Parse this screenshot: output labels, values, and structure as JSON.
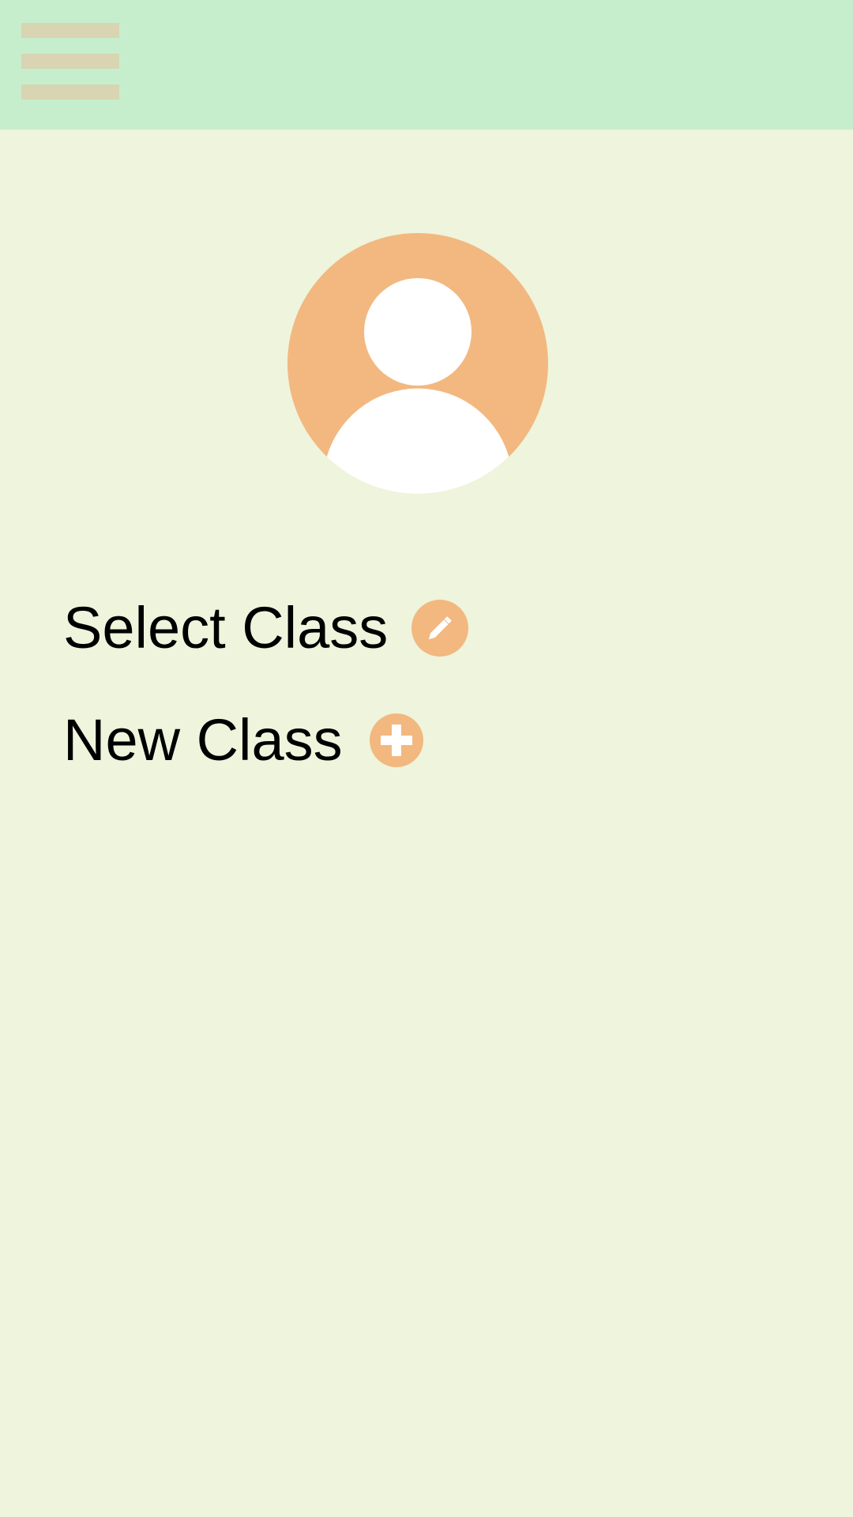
{
  "top_bar": {
    "background_color": "#c6eecd",
    "menu_icon": "hamburger-menu-icon",
    "menu_icon_color": "#d9d4b1"
  },
  "profile": {
    "avatar_icon": "user-avatar-icon",
    "avatar_color": "#f2b880"
  },
  "menu": {
    "select_class": {
      "label": "Select Class",
      "icon": "pencil-icon"
    },
    "new_class": {
      "label": "New Class",
      "icon": "plus-icon"
    }
  },
  "colors": {
    "page_background": "#eff4dc",
    "accent": "#f2b880",
    "text": "#000000"
  }
}
